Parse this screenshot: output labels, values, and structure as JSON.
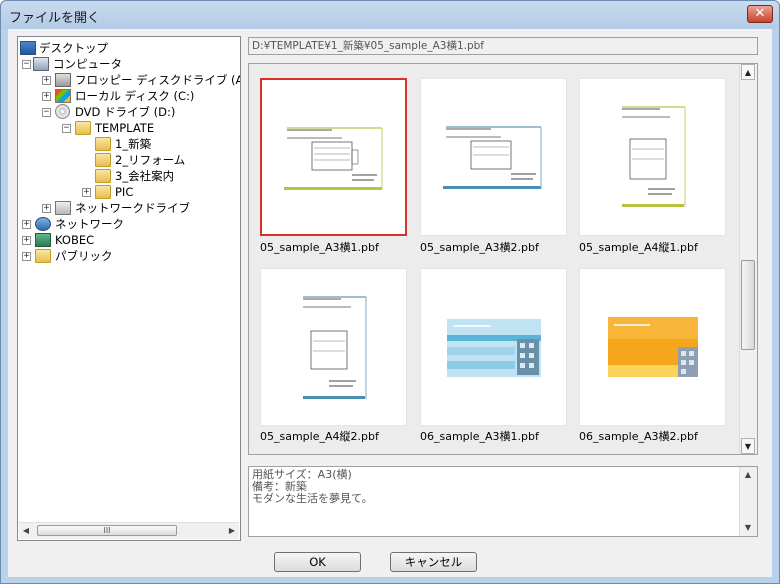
{
  "window": {
    "title": "ファイルを開く",
    "close_label": "✕"
  },
  "tree": {
    "items": [
      {
        "label": "デスクトップ"
      },
      {
        "label": "コンピュータ"
      },
      {
        "label": "フロッピー ディスクドライブ (A:"
      },
      {
        "label": "ローカル ディスク (C:)"
      },
      {
        "label": "DVD ドライブ (D:)"
      },
      {
        "label": "TEMPLATE"
      },
      {
        "label": "1_新築"
      },
      {
        "label": "2_リフォーム"
      },
      {
        "label": "3_会社案内"
      },
      {
        "label": "PIC"
      },
      {
        "label": "ネットワークドライブ"
      },
      {
        "label": "ネットワーク"
      },
      {
        "label": "KOBEC"
      },
      {
        "label": "パブリック"
      }
    ],
    "scroll_thumb_label": "III"
  },
  "path": {
    "value": "D:¥TEMPLATE¥1_新築¥05_sample_A3横1.pbf"
  },
  "thumbnails": [
    {
      "name": "05_sample_A3横1.pbf",
      "selected": true
    },
    {
      "name": "05_sample_A3横2.pbf",
      "selected": false
    },
    {
      "name": "05_sample_A4縦1.pbf",
      "selected": false
    },
    {
      "name": "05_sample_A4縦2.pbf",
      "selected": false
    },
    {
      "name": "06_sample_A3横1.pbf",
      "selected": false
    },
    {
      "name": "06_sample_A3横2.pbf",
      "selected": false
    }
  ],
  "info": {
    "lines": [
      "用紙サイズ：A3(横)",
      "備考：新築",
      "モダンな生活を夢見て。"
    ]
  },
  "buttons": {
    "ok": "OK",
    "cancel": "キャンセル"
  }
}
